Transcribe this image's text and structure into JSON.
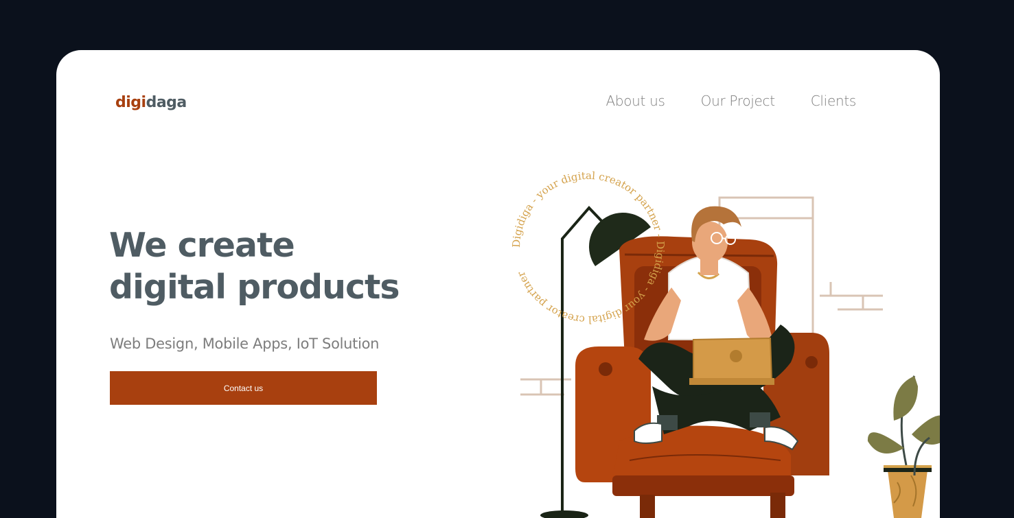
{
  "brand": {
    "part1": "digi",
    "part2": "daga"
  },
  "nav": {
    "items": [
      {
        "label": "About us"
      },
      {
        "label": "Our Project"
      },
      {
        "label": "Clients"
      }
    ]
  },
  "hero": {
    "title_line1": "We create",
    "title_line2": "digital products",
    "subtitle": "Web Design, Mobile Apps, IoT Solution",
    "cta_label": "Contact us"
  },
  "badge": {
    "circle_text": "Digidiga - your digital creator partner - Digidiga - your digital creator partner"
  },
  "colors": {
    "background": "#0b111c",
    "card": "#ffffff",
    "accent": "#a8400f",
    "heading": "#4f5c63",
    "muted": "#7d7d7d",
    "gold": "#d4a24c"
  }
}
